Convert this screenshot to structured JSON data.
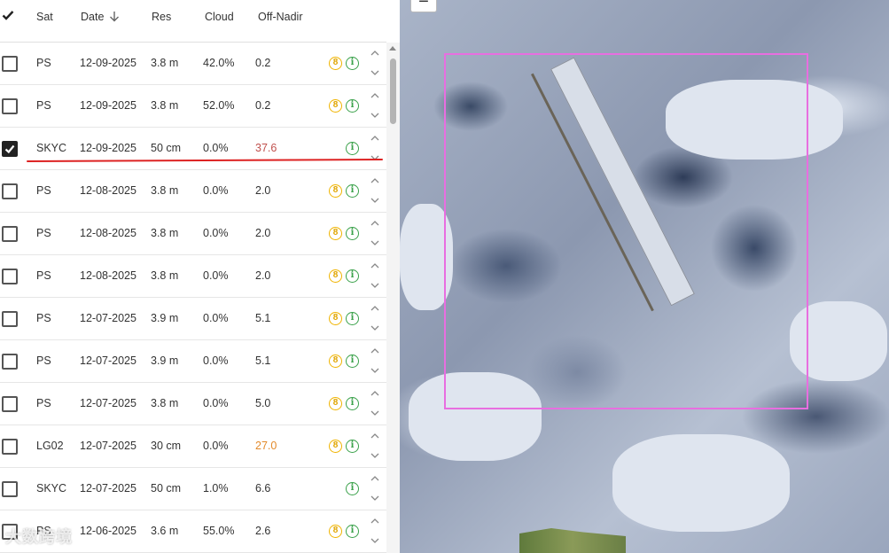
{
  "table": {
    "columns": [
      "Sat",
      "Date",
      "Res",
      "Cloud",
      "Off-Nadir"
    ],
    "rows": [
      {
        "sat": "PS",
        "date": "12-09-2025",
        "res": "3.8 m",
        "cloud": "42.0%",
        "off": "0.2",
        "badge8": "8",
        "info": "i",
        "checked": false,
        "offColor": ""
      },
      {
        "sat": "PS",
        "date": "12-09-2025",
        "res": "3.8 m",
        "cloud": "52.0%",
        "off": "0.2",
        "badge8": "8",
        "info": "i",
        "checked": false,
        "offColor": ""
      },
      {
        "sat": "SKYC",
        "date": "12-09-2025",
        "res": "50 cm",
        "cloud": "0.0%",
        "off": "37.6",
        "badge8": "",
        "info": "i",
        "checked": true,
        "offColor": "red"
      },
      {
        "sat": "PS",
        "date": "12-08-2025",
        "res": "3.8 m",
        "cloud": "0.0%",
        "off": "2.0",
        "badge8": "8",
        "info": "i",
        "checked": false,
        "offColor": ""
      },
      {
        "sat": "PS",
        "date": "12-08-2025",
        "res": "3.8 m",
        "cloud": "0.0%",
        "off": "2.0",
        "badge8": "8",
        "info": "i",
        "checked": false,
        "offColor": ""
      },
      {
        "sat": "PS",
        "date": "12-08-2025",
        "res": "3.8 m",
        "cloud": "0.0%",
        "off": "2.0",
        "badge8": "8",
        "info": "i",
        "checked": false,
        "offColor": ""
      },
      {
        "sat": "PS",
        "date": "12-07-2025",
        "res": "3.9 m",
        "cloud": "0.0%",
        "off": "5.1",
        "badge8": "8",
        "info": "i",
        "checked": false,
        "offColor": ""
      },
      {
        "sat": "PS",
        "date": "12-07-2025",
        "res": "3.9 m",
        "cloud": "0.0%",
        "off": "5.1",
        "badge8": "8",
        "info": "i",
        "checked": false,
        "offColor": ""
      },
      {
        "sat": "PS",
        "date": "12-07-2025",
        "res": "3.8 m",
        "cloud": "0.0%",
        "off": "5.0",
        "badge8": "8",
        "info": "i",
        "checked": false,
        "offColor": ""
      },
      {
        "sat": "LG02",
        "date": "12-07-2025",
        "res": "30 cm",
        "cloud": "0.0%",
        "off": "27.0",
        "badge8": "8",
        "info": "i",
        "checked": false,
        "offColor": "orange"
      },
      {
        "sat": "SKYC",
        "date": "12-07-2025",
        "res": "50 cm",
        "cloud": "1.0%",
        "off": "6.6",
        "badge8": "",
        "info": "i",
        "checked": false,
        "offColor": ""
      },
      {
        "sat": "PS",
        "date": "12-06-2025",
        "res": "3.6 m",
        "cloud": "55.0%",
        "off": "2.6",
        "badge8": "8",
        "info": "i",
        "checked": false,
        "offColor": ""
      }
    ]
  },
  "map": {
    "zoom_out_label": "−"
  },
  "watermark": "大数跨境",
  "colors": {
    "aoi_outline": "#e86ee0",
    "badge_orbit": "#f0b400",
    "info": "#3aa14a",
    "off_nadir_high": "#c0504d",
    "off_nadir_mid": "#e38a2a",
    "annotation_line": "#dd2222"
  },
  "icons": {
    "select_all": "checkmark-icon",
    "sort": "arrow-down-icon",
    "badge": "number-8-badge-icon",
    "info": "info-circle-icon",
    "expand_up": "chevron-up-icon",
    "expand_down": "chevron-down-icon"
  }
}
